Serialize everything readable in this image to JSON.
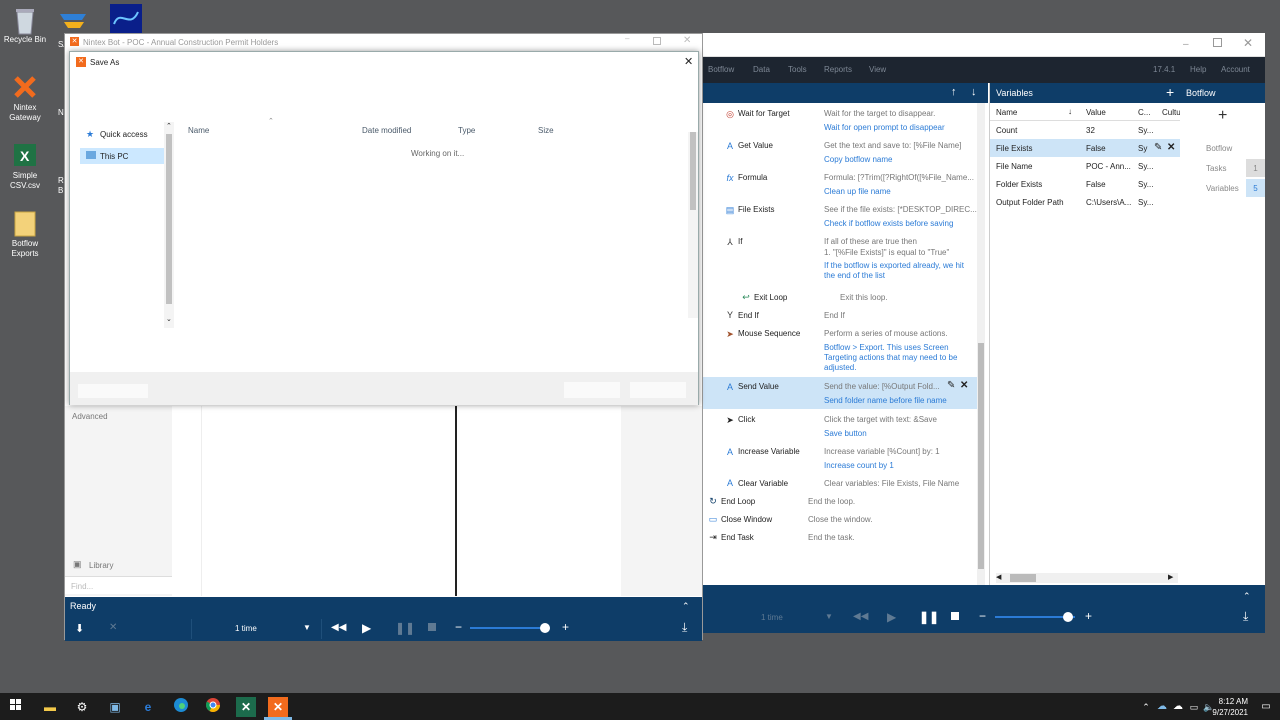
{
  "desktop": {
    "icons": [
      {
        "label": "Recycle Bin"
      },
      {
        "label": "Nintex Gateway"
      },
      {
        "label": "Simple CSV.csv"
      },
      {
        "label": "Botflow Exports"
      }
    ],
    "partial_labels": [
      "SA",
      "Ni",
      "R",
      "B"
    ]
  },
  "nintex_window": {
    "menu": [
      "Botflow",
      "Data",
      "Tools",
      "Reports",
      "View",
      "17.4.1",
      "Help",
      "Account"
    ],
    "steps": [
      {
        "name": "Wait for Target",
        "desc": "Wait for the target to disappear.",
        "comment": "Wait for open prompt to disappear",
        "icon": "target-icon"
      },
      {
        "name": "Get Value",
        "desc": "Get the text and save to: [%File Name]",
        "comment": "Copy botflow name",
        "icon": "get-value-icon"
      },
      {
        "name": "Formula",
        "desc": "Formula: [?Trim([?RightOf([%File_Name...",
        "comment": "Clean up file name",
        "icon": "formula-icon"
      },
      {
        "name": "File Exists",
        "desc": "See if the file exists: [*DESKTOP_DIREC...",
        "comment": "Check if botflow exists before saving",
        "icon": "file-exists-icon"
      },
      {
        "name": "If",
        "desc": "If all of these are true then",
        "desc2": "1. \"[%File Exists]\" is equal to \"True\"",
        "comment": "If the botflow is exported already, we hit",
        "comment2": "the end of the list",
        "icon": "if-icon"
      },
      {
        "name": "Exit Loop",
        "desc": "Exit this loop.",
        "icon": "exit-loop-icon"
      },
      {
        "name": "End If",
        "desc": "End If",
        "icon": "end-if-icon"
      },
      {
        "name": "Mouse Sequence",
        "desc": "Perform a series of mouse actions.",
        "comment": "Botflow > Export. This uses Screen",
        "comment2": "Targeting actions that may need to be",
        "comment3": "adjusted.",
        "icon": "mouse-icon"
      },
      {
        "name": "Send Value",
        "desc": "Send the value: [%Output Fold...",
        "comment": "Send folder name before file name",
        "icon": "send-value-icon"
      },
      {
        "name": "Click",
        "desc": "Click the target with text: &Save",
        "comment": "Save button",
        "icon": "click-icon"
      },
      {
        "name": "Increase Variable",
        "desc": "Increase variable [%Count] by: 1",
        "comment": "Increase count by 1",
        "icon": "increase-icon"
      },
      {
        "name": "Clear Variable",
        "desc": "Clear variables: File Exists, File Name",
        "icon": "clear-icon"
      },
      {
        "name": "End Loop",
        "desc": "End the loop.",
        "icon": "end-loop-icon"
      },
      {
        "name": "Close Window",
        "desc": "Close the window.",
        "icon": "close-window-icon"
      },
      {
        "name": "End Task",
        "desc": "End the task.",
        "icon": "end-task-icon"
      }
    ],
    "variables": {
      "title": "Variables",
      "columns": [
        "Name",
        "Value",
        "C...",
        "Cultur"
      ],
      "rows": [
        {
          "name": "Count",
          "value": "32",
          "c": "Sy..."
        },
        {
          "name": "File Exists",
          "value": "False",
          "c": "Sy"
        },
        {
          "name": "File Name",
          "value": "POC - Ann...",
          "c": "Sy..."
        },
        {
          "name": "Folder Exists",
          "value": "False",
          "c": "Sy..."
        },
        {
          "name": "Output Folder Path",
          "value": "C:\\Users\\A...",
          "c": "Sy..."
        }
      ]
    },
    "botflow_panel": {
      "title": "Botflow",
      "items": [
        {
          "label": "Botflow",
          "count": ""
        },
        {
          "label": "Tasks",
          "count": "1"
        },
        {
          "label": "Variables",
          "count": "5"
        }
      ]
    },
    "bottom": {
      "runs": "1 time"
    }
  },
  "bot_window": {
    "title": "Nintex Bot - POC - Annual Construction Permit Holders",
    "advanced": "Advanced",
    "library": "Library",
    "find_placeholder": "Find...",
    "status": "Ready",
    "runs": "1 time"
  },
  "save_as": {
    "title": "Save As",
    "nav": [
      "Quick access",
      "This PC"
    ],
    "columns": [
      "Name",
      "Date modified",
      "Type",
      "Size"
    ],
    "status": "Working on it..."
  },
  "taskbar": {
    "time": "8:12 AM",
    "date": "9/27/2021"
  },
  "colors": {
    "nintex_navy": "#0e3d68",
    "nintex_dark": "#1d2530",
    "link_blue": "#2b7bd6",
    "selected_row": "#cde4f7"
  }
}
